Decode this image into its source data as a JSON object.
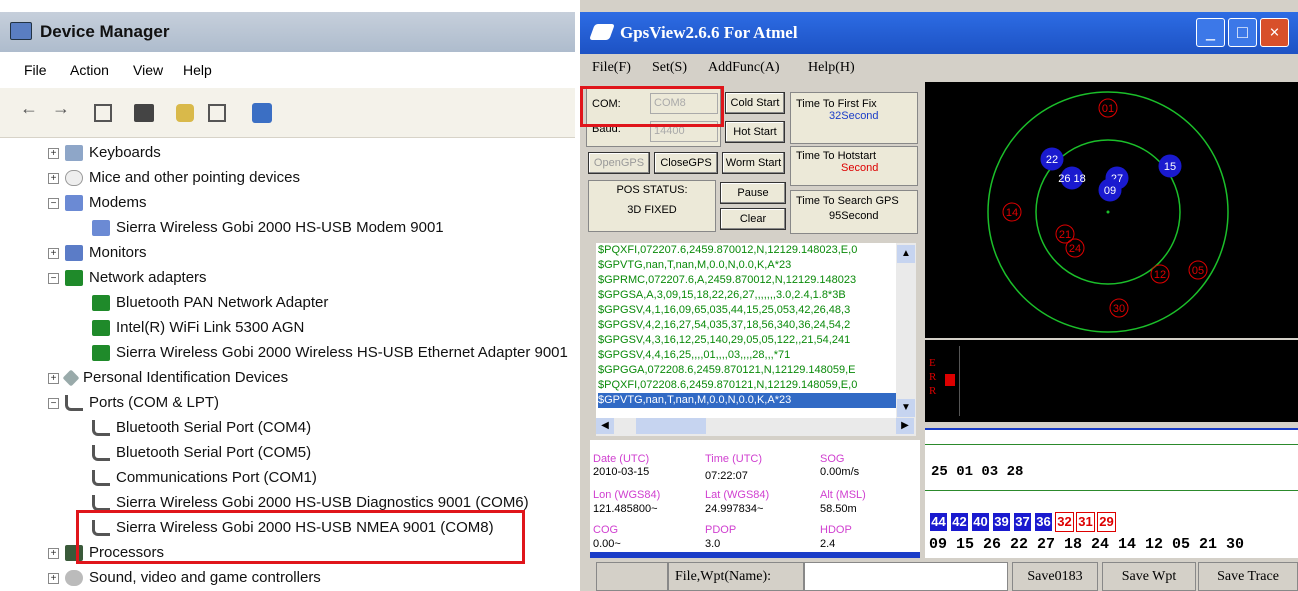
{
  "dm": {
    "title": "Device Manager",
    "menu": [
      "File",
      "Action",
      "View",
      "Help"
    ],
    "tree": [
      {
        "label": "Keyboards",
        "exp": "+",
        "indent": 0,
        "icon": "kb"
      },
      {
        "label": "Mice and other pointing devices",
        "exp": "+",
        "indent": 0,
        "icon": "mouse"
      },
      {
        "label": "Modems",
        "exp": "−",
        "indent": 0,
        "icon": "modem"
      },
      {
        "label": "Sierra Wireless Gobi 2000 HS-USB Modem 9001",
        "exp": "",
        "indent": 1,
        "icon": "modem"
      },
      {
        "label": "Monitors",
        "exp": "+",
        "indent": 0,
        "icon": "mon"
      },
      {
        "label": "Network adapters",
        "exp": "−",
        "indent": 0,
        "icon": "net"
      },
      {
        "label": "Bluetooth PAN Network Adapter",
        "exp": "",
        "indent": 1,
        "icon": "net"
      },
      {
        "label": "Intel(R) WiFi Link 5300 AGN",
        "exp": "",
        "indent": 1,
        "icon": "net"
      },
      {
        "label": "Sierra Wireless Gobi 2000 Wireless HS-USB Ethernet Adapter 9001",
        "exp": "",
        "indent": 1,
        "icon": "net"
      },
      {
        "label": "Personal Identification Devices",
        "exp": "+",
        "indent": 0,
        "icon": "pid"
      },
      {
        "label": "Ports (COM & LPT)",
        "exp": "−",
        "indent": 0,
        "icon": "port"
      },
      {
        "label": "Bluetooth Serial Port (COM4)",
        "exp": "",
        "indent": 1,
        "icon": "port"
      },
      {
        "label": "Bluetooth Serial Port (COM5)",
        "exp": "",
        "indent": 1,
        "icon": "port"
      },
      {
        "label": "Communications Port (COM1)",
        "exp": "",
        "indent": 1,
        "icon": "port"
      },
      {
        "label": "Sierra Wireless Gobi 2000 HS-USB Diagnostics 9001 (COM6)",
        "exp": "",
        "indent": 1,
        "icon": "port"
      },
      {
        "label": "Sierra Wireless Gobi 2000 HS-USB NMEA 9001 (COM8)",
        "exp": "",
        "indent": 1,
        "icon": "port"
      },
      {
        "label": "Processors",
        "exp": "+",
        "indent": 0,
        "icon": "proc"
      },
      {
        "label": "Sound, video and game controllers",
        "exp": "+",
        "indent": 0,
        "icon": "snd"
      }
    ]
  },
  "gps": {
    "title": "GpsView2.6.6 For Atmel",
    "menu": [
      "File(F)",
      "Set(S)",
      "AddFunc(A)",
      "Help(H)"
    ],
    "com_label": "COM:",
    "com_value": "COM8",
    "baud_label": "Baud:",
    "baud_value": "14400",
    "btn_cold": "Cold Start",
    "btn_hot": "Hot Start",
    "btn_open": "OpenGPS",
    "btn_close": "CloseGPS",
    "btn_worm": "Worm Start",
    "btn_pause": "Pause",
    "btn_clear": "Clear",
    "ttff_label": "Time To First Fix",
    "ttff_value": "32Second",
    "tth_label": "Time To Hotstart",
    "tth_value": "Second",
    "tts_label": "Time To Search GPS",
    "tts_value": "95Second",
    "pos_label": "POS STATUS:",
    "pos_value": "3D FIXED",
    "nmea": [
      "$PQXFI,072207.6,2459.870012,N,12129.148023,E,0",
      "$GPVTG,nan,T,nan,M,0.0,N,0.0,K,A*23",
      "$GPRMC,072207.6,A,2459.870012,N,12129.148023",
      "$GPGSA,A,3,09,15,18,22,26,27,,,,,,,3.0,2.4,1.8*3B",
      "$GPGSV,4,1,16,09,65,035,44,15,25,053,42,26,48,3",
      "$GPGSV,4,2,16,27,54,035,37,18,56,340,36,24,54,2",
      "$GPGSV,4,3,16,12,25,140,29,05,05,122,,21,54,241",
      "$GPGSV,4,4,16,25,,,,01,,,,03,,,,28,,,*71",
      "$GPGGA,072208.6,2459.870121,N,12129.148059,E",
      "$PQXFI,072208.6,2459.870121,N,12129.148059,E,0",
      "$GPVTG,nan,T,nan,M,0.0,N,0.0,K,A*23"
    ],
    "info": {
      "date_l": "Date (UTC)",
      "date_v": "2010-03-15",
      "time_l": "Time (UTC)",
      "time_v": "07:22:07",
      "sog_l": "SOG",
      "sog_v": "0.00m/s",
      "lon_l": "Lon (WGS84)",
      "lon_v": "121.485800~",
      "lat_l": "Lat (WGS84)",
      "lat_v": "24.997834~",
      "alt_l": "Alt (MSL)",
      "alt_v": "58.50m",
      "cog_l": "COG",
      "cog_v": "0.00~",
      "pdop_l": "PDOP",
      "pdop_v": "3.0",
      "hdop_l": "HDOP",
      "hdop_v": "2.4"
    },
    "err_letters": [
      "E",
      "R",
      "R"
    ],
    "sat_row_top": "25 01 03 28",
    "snr_blue": [
      "44",
      "42",
      "40",
      "39",
      "37",
      "36"
    ],
    "snr_red": [
      "32",
      "31",
      "29"
    ],
    "sat_row_bottom": "09 15 26 22 27 18 24 14 12 05 21 30",
    "sky_blue": [
      {
        "id": "22"
      },
      {
        "id": "15"
      },
      {
        "id": "26 18"
      },
      {
        "id": "27"
      },
      {
        "id": "09"
      }
    ],
    "sky_red": [
      {
        "id": "01"
      },
      {
        "id": "14"
      },
      {
        "id": "21"
      },
      {
        "id": "24"
      },
      {
        "id": "12"
      },
      {
        "id": "05"
      },
      {
        "id": "30"
      }
    ],
    "footer_label": "File,Wpt(Name):",
    "save0183": "Save0183",
    "savewpt": "Save Wpt",
    "savetrace": "Save Trace"
  }
}
